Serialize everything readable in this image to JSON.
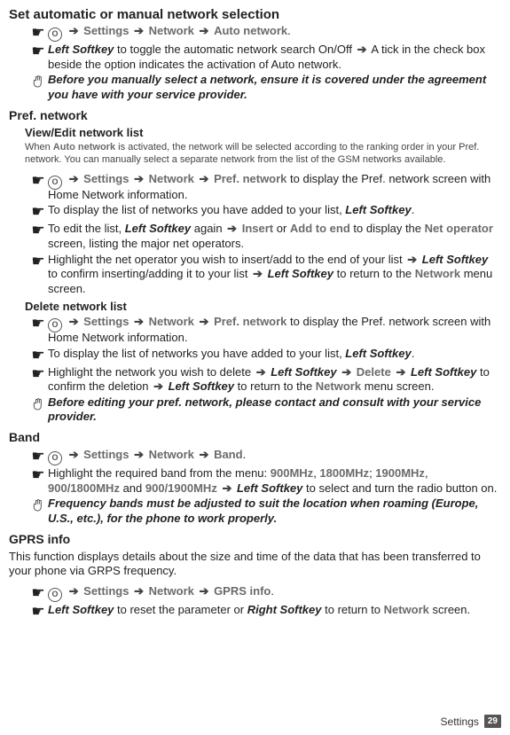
{
  "title1": "Set automatic or manual network selection",
  "arrow": "➔",
  "nav": {
    "settings": "Settings",
    "network": "Network",
    "auto": "Auto network",
    "pref": "Pref. network",
    "band": "Band",
    "gprs": "GPRS info"
  },
  "auto": {
    "left": "Left Softkey",
    "line1_a": " to toggle the automatic network search On/Off ",
    "line1_b": " A tick in the check box beside the option indicates the activation of Auto network."
  },
  "hand1": "Before you manually select a network, ensure it is covered under the agreement you have with your service provider.",
  "pref_h": "Pref. network",
  "view_h": "View/Edit network list",
  "view_small_a": "When ",
  "view_small_auto": "Auto network",
  "view_small_b": " is activated, the network will be selected according to the ranking order in your Pref. network. You can manually select a separate network from the list of the GSM networks available.",
  "pref1_tail": " to display the Pref. network screen with Home Network information.",
  "pref2_a": "To display the list of networks you have added to your list, ",
  "pref2_b": "Left Softkey",
  "pref3_a": "To edit the list, ",
  "pref3_b": "Left Softkey",
  "pref3_c": " again ",
  "pref3_ins": "Insert",
  "pref3_or": " or ",
  "pref3_add": "Add to end",
  "pref3_d": " to display the ",
  "pref3_net": "Net operator",
  "pref3_e": " screen, listing the major net operators.",
  "pref4_a": "Highlight the net operator you wish to insert/add to the end of your list ",
  "pref4_b": "Left Softkey",
  "pref4_c": " to confirm inserting/adding it to your list ",
  "pref4_d": "Left Softkey",
  "pref4_e": " to return to the ",
  "pref4_net": "Network",
  "pref4_f": " menu screen.",
  "del_h": "Delete network list",
  "del1_tail": " to display the Pref. network screen with Home Network information.",
  "del2_a": "To display the list of networks you have added to your list, ",
  "del2_b": "Left Softkey",
  "del3_a": "Highlight the network you wish to delete ",
  "del3_b": "Left Softkey",
  "del3_del": "Delete",
  "del3_c": "Left Softkey",
  "del3_d": " to confirm the deletion ",
  "del3_e": "Left Softkey",
  "del3_f": " to return to the ",
  "del3_net": "Network",
  "del3_g": " menu screen.",
  "hand2": "Before editing your pref. network, please contact and consult with your service provider.",
  "band_h": "Band",
  "band2_a": "Highlight the required band from the menu: ",
  "band2_v1": "900MHz",
  "band2_v2": "1800MHz",
  "band2_v3": "1900MHz",
  "band2_v4": "900/1800MHz",
  "band2_and": " and ",
  "band2_v5": "900/1900MHz",
  "band2_b": "Left Softkey",
  "band2_c": " to select and turn the radio button on.",
  "hand3": "Frequency bands must be adjusted to suit the location when roaming (Europe, U.S., etc.), for the phone to work properly.",
  "gprs_h": "GPRS info",
  "gprs_intro": "This function displays details about the size and time of the data that has been transferred to your phone via GRPS frequency.",
  "gprs2_a": "Left Softkey",
  "gprs2_b": " to reset the parameter or ",
  "gprs2_c": "Right Softkey",
  "gprs2_d": " to return to ",
  "gprs2_net": "Network",
  "gprs2_e": " screen.",
  "footer_chap": "Settings",
  "footer_pg": "29",
  "dot": ".",
  "semicolon": "; ",
  "comma": ", ",
  "o_letter": "O"
}
